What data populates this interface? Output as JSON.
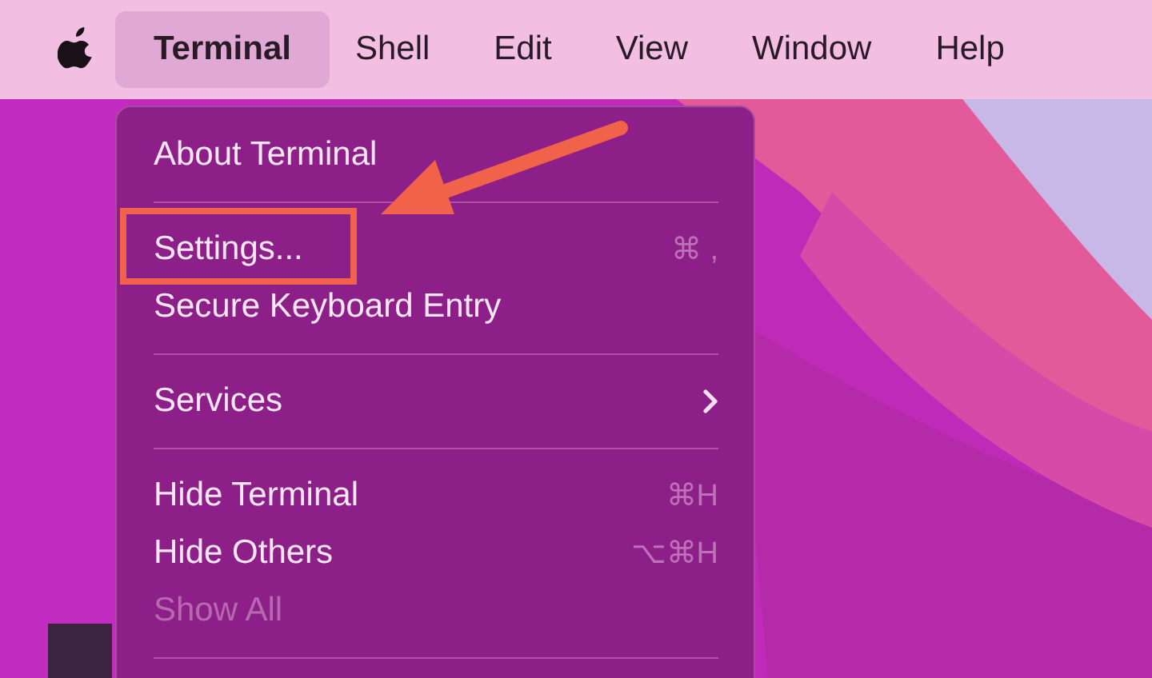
{
  "menu_bar": {
    "items": [
      {
        "label": "Terminal",
        "selected": true
      },
      {
        "label": "Shell",
        "selected": false
      },
      {
        "label": "Edit",
        "selected": false
      },
      {
        "label": "View",
        "selected": false
      },
      {
        "label": "Window",
        "selected": false
      },
      {
        "label": "Help",
        "selected": false
      }
    ]
  },
  "dropdown": {
    "items": [
      {
        "kind": "item",
        "label": "About Terminal",
        "disabled": false,
        "annotated": false
      },
      {
        "kind": "separator"
      },
      {
        "kind": "item",
        "label": "Settings...",
        "shortcut": "⌘ ,",
        "disabled": false,
        "annotated": true
      },
      {
        "kind": "item",
        "label": "Secure Keyboard Entry",
        "disabled": false,
        "annotated": false
      },
      {
        "kind": "separator"
      },
      {
        "kind": "item",
        "label": "Services",
        "submenu": true,
        "disabled": false,
        "annotated": false
      },
      {
        "kind": "separator"
      },
      {
        "kind": "item",
        "label": "Hide Terminal",
        "shortcut": "⌘H",
        "disabled": false,
        "annotated": false
      },
      {
        "kind": "item",
        "label": "Hide Others",
        "shortcut": "⌥⌘H",
        "disabled": false,
        "annotated": false
      },
      {
        "kind": "item",
        "label": "Show All",
        "disabled": true,
        "annotated": false
      },
      {
        "kind": "separator"
      }
    ]
  }
}
